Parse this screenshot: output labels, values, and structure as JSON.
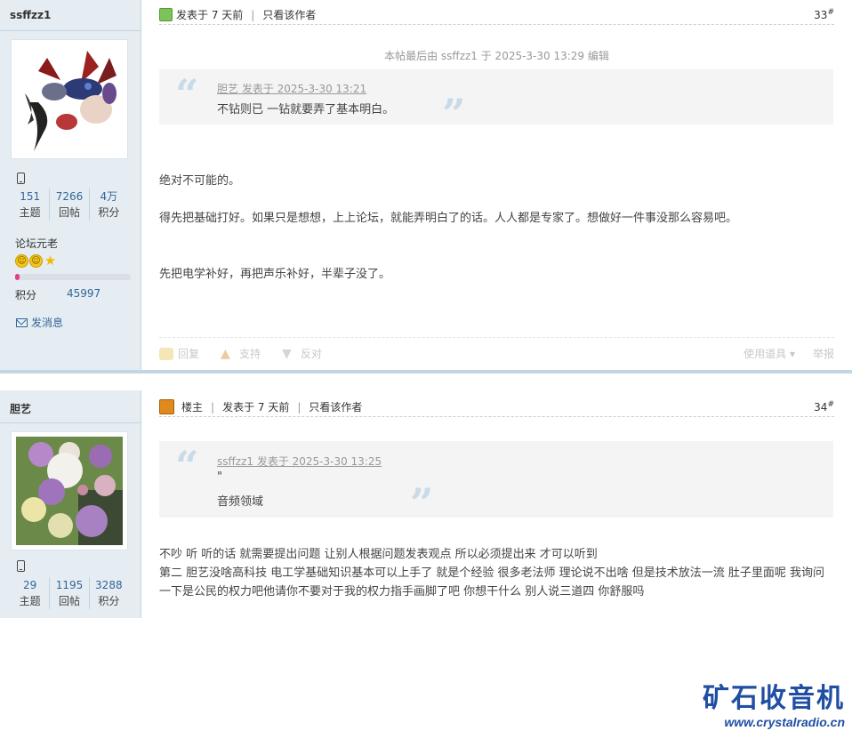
{
  "posts": [
    {
      "author": "ssffzz1",
      "stats": [
        {
          "num": "151",
          "label": "主题"
        },
        {
          "num": "7266",
          "label": "回帖"
        },
        {
          "num": "4万",
          "label": "积分"
        }
      ],
      "rank": "论坛元老",
      "credit_label": "积分",
      "credit_value": "45997",
      "credit_progress": 0.04,
      "message_label": "发消息",
      "posted": "发表于 7 天前",
      "author_only": "只看该作者",
      "floor": "33",
      "floor_sup": "#",
      "edited": "本帖最后由 ssffzz1 于 2025-3-30 13:29 编辑",
      "quote_head": "胆艺 发表于 2025-3-30 13:21",
      "quote_text": "不钻则已  一钻就要弄了基本明白。",
      "body": [
        "绝对不可能的。",
        "得先把基础打好。如果只是想想，上上论坛，就能弄明白了的话。人人都是专家了。想做好一件事没那么容易吧。",
        "先把电学补好，再把声乐补好，半辈子没了。"
      ],
      "actions": {
        "reply": "回复",
        "support": "支持",
        "oppose": "反对",
        "tools": "使用道具",
        "report": "举报"
      }
    },
    {
      "author": "胆艺",
      "stats": [
        {
          "num": "29",
          "label": "主题"
        },
        {
          "num": "1195",
          "label": "回帖"
        },
        {
          "num": "3288",
          "label": "积分"
        }
      ],
      "host_label": "楼主",
      "posted": "发表于 7 天前",
      "author_only": "只看该作者",
      "floor": "34",
      "floor_sup": "#",
      "quote_head": "ssffzz1 发表于 2025-3-30 13:25",
      "quote_line1": "\"",
      "quote_text": "音频领域",
      "body": [
        "不吵  听  听的话 就需要提出问题 让别人根据问题发表观点  所以必须提出来  才可以听到",
        "第二 胆艺没啥高科技  电工学基础知识基本可以上手了  就是个经验  很多老法师  理论说不出啥  但是技术放法一流  肚子里面呢   我询问一下是公民的权力吧他请你不要对于我的权力指手画脚了吧  你想干什么  别人说三道四 你舒服吗"
      ]
    }
  ],
  "watermark": {
    "cn": "矿石收音机",
    "en": "www.crystalradio.cn"
  }
}
